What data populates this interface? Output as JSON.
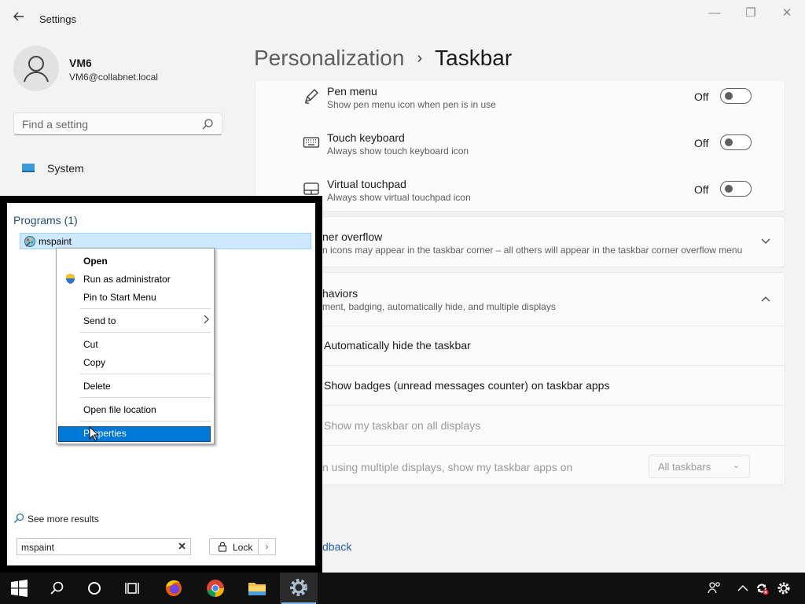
{
  "window": {
    "title": "Settings",
    "back_icon": "back-arrow-icon",
    "minimize": "—",
    "maximize": "❐",
    "close": "✕"
  },
  "user": {
    "name": "VM6",
    "email": "VM6@collabnet.local"
  },
  "search": {
    "placeholder": "Find a setting"
  },
  "nav": {
    "items": [
      {
        "label": "System",
        "icon": "system-icon"
      }
    ]
  },
  "breadcrumb": {
    "parent": "Personalization",
    "separator": "›",
    "current": "Taskbar"
  },
  "settings_rows": [
    {
      "title": "Pen menu",
      "desc": "Show pen menu icon when pen is in use",
      "state": "Off",
      "icon": "pen-icon"
    },
    {
      "title": "Touch keyboard",
      "desc": "Always show touch keyboard icon",
      "state": "Off",
      "icon": "keyboard-icon"
    },
    {
      "title": "Virtual touchpad",
      "desc": "Always show virtual touchpad icon",
      "state": "Off",
      "icon": "touchpad-icon"
    }
  ],
  "corner_overflow": {
    "title": "ner overflow",
    "desc": "n icons may appear in the taskbar corner – all others will appear in the taskbar corner overflow menu"
  },
  "behaviors": {
    "title": "haviors",
    "desc": "ment, badging, automatically hide, and multiple displays",
    "options": [
      {
        "label": "Automatically hide the taskbar"
      },
      {
        "label": "Show badges (unread messages counter) on taskbar apps"
      },
      {
        "label": "Show my taskbar on all displays"
      }
    ],
    "multi_display_label": "n using multiple displays, show my taskbar apps on",
    "multi_display_value": "All taskbars"
  },
  "feedback_link": "dback",
  "start_menu": {
    "programs_header": "Programs (1)",
    "program_item": "mspaint",
    "see_more": "See more results",
    "search_value": "mspaint",
    "lock_label": "Lock"
  },
  "context_menu": {
    "items": [
      "Open",
      "Run as administrator",
      "Pin to Start Menu",
      "Send to",
      "Cut",
      "Copy",
      "Delete",
      "Open file location",
      "Properties"
    ]
  },
  "taskbar": {
    "icons": [
      "windows-start-icon",
      "search-icon",
      "cortana-icon",
      "task-view-icon",
      "firefox-icon",
      "chrome-icon",
      "file-explorer-icon",
      "settings-gear-icon"
    ],
    "tray_icons": [
      "people-icon",
      "chevron-up-icon",
      "sync-error-icon",
      "settings-gear-icon"
    ]
  },
  "colors": {
    "accent": "#0078d7",
    "highlight": "#cde8ff",
    "taskbar": "#101010"
  }
}
